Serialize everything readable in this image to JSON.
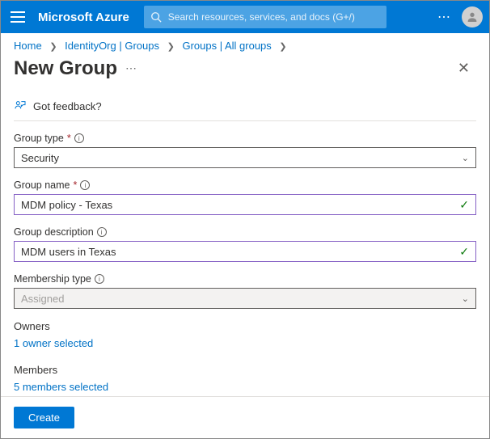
{
  "topbar": {
    "brand": "Microsoft Azure",
    "search_placeholder": "Search resources, services, and docs (G+/)"
  },
  "breadcrumbs": {
    "b0": "Home",
    "b1": "IdentityOrg | Groups",
    "b2": "Groups | All groups"
  },
  "header": {
    "title": "New Group"
  },
  "feedback_label": "Got feedback?",
  "form": {
    "group_type_label": "Group type",
    "group_type_value": "Security",
    "group_name_label": "Group name",
    "group_name_value": "MDM policy - Texas",
    "group_desc_label": "Group description",
    "group_desc_value": "MDM users in Texas",
    "membership_label": "Membership type",
    "membership_value": "Assigned",
    "owners_label": "Owners",
    "owners_link": "1 owner selected",
    "members_label": "Members",
    "members_link": "5 members selected"
  },
  "footer": {
    "create": "Create"
  }
}
